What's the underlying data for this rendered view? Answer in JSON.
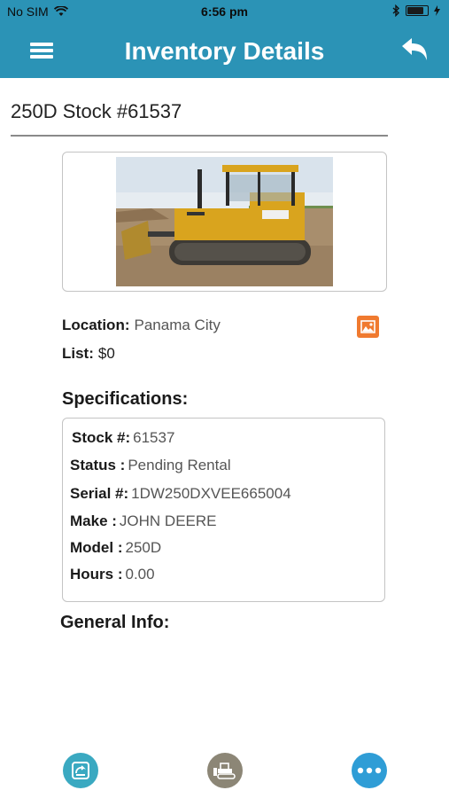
{
  "status_bar": {
    "carrier": "No SIM",
    "time": "6:56 pm",
    "battery_level": 0.85
  },
  "header": {
    "title": "Inventory Details",
    "menu_icon": "hamburger-menu-icon",
    "back_icon": "reply-arrow-icon"
  },
  "item": {
    "title": "250D Stock #61537",
    "location_label": "Location:",
    "location_value": "Panama City",
    "list_label": "List:",
    "list_value": "$0",
    "gallery_icon": "image-gallery-icon"
  },
  "specifications": {
    "heading": "Specifications:",
    "rows": [
      {
        "label": "Stock #:",
        "value": "61537"
      },
      {
        "label": "Status :",
        "value": "Pending Rental"
      },
      {
        "label": "Serial #:",
        "value": "1DW250DXVEE665004"
      },
      {
        "label": "Make :",
        "value": "JOHN DEERE"
      },
      {
        "label": "Model :",
        "value": "250D"
      },
      {
        "label": "Hours :",
        "value": "0.00"
      }
    ]
  },
  "general_info": {
    "heading": "General Info:"
  },
  "bottom_bar": {
    "items": [
      {
        "icon": "inventory-icon",
        "color": "#3aa9c1"
      },
      {
        "icon": "bulldozer-icon",
        "color": "#8c8676"
      },
      {
        "icon": "more-icon",
        "color": "#2f9dd6"
      }
    ]
  },
  "colors": {
    "header": "#2b93b6",
    "accent_orange": "#f07a2f"
  }
}
